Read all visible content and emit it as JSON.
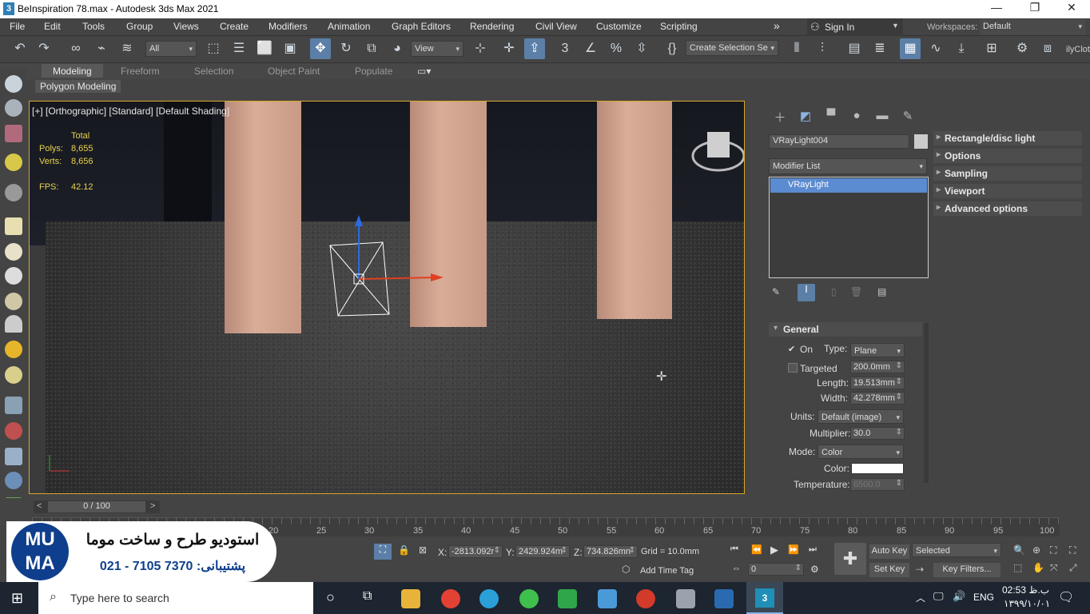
{
  "window": {
    "title": "BeInspiration 78.max - Autodesk 3ds Max 2021",
    "minimize": "—",
    "maximize": "❐",
    "close": "✕"
  },
  "menu": [
    "File",
    "Edit",
    "Tools",
    "Group",
    "Views",
    "Create",
    "Modifiers",
    "Animation",
    "Graph Editors",
    "Rendering",
    "Civil View",
    "Customize",
    "Scripting"
  ],
  "signin": {
    "label": "Sign In"
  },
  "workspaces": {
    "label": "Workspaces:",
    "value": "Default"
  },
  "toolbar": {
    "filter_value": "All",
    "view_value": "View",
    "selection_set_placeholder": "Create Selection Se",
    "cloth_label": "ilyClot"
  },
  "ribbon": {
    "tabs": [
      "Modeling",
      "Freeform",
      "Selection",
      "Object Paint",
      "Populate"
    ],
    "sub_tab": "Polygon Modeling"
  },
  "viewport": {
    "label": "[+] [Orthographic] [Standard] [Default Shading]",
    "stats": {
      "total_label": "Total",
      "polys_label": "Polys:",
      "polys": "8,655",
      "verts_label": "Verts:",
      "verts": "8,656",
      "fps_label": "FPS:",
      "fps": "42.12"
    }
  },
  "command_panel": {
    "object_name": "VRayLight004",
    "modifier_list": "Modifier List",
    "stack_item": "VRayLight",
    "rollouts": [
      "Rectangle/disc light",
      "Options",
      "Sampling",
      "Viewport",
      "Advanced options"
    ],
    "general": {
      "title": "General",
      "on_label": "On",
      "type_label": "Type:",
      "type_value": "Plane",
      "targeted_label": "Targeted",
      "targeted_value": "200.0mm",
      "length_label": "Length:",
      "length_value": "19.513mm",
      "width_label": "Width:",
      "width_value": "42.278mm",
      "units_label": "Units:",
      "units_value": "Default (image)",
      "multiplier_label": "Multiplier:",
      "multiplier_value": "30.0",
      "mode_label": "Mode:",
      "mode_value": "Color",
      "color_label": "Color:",
      "temperature_label": "Temperature:",
      "temperature_value": "6500.0"
    }
  },
  "timeline": {
    "frame": "0 / 100",
    "ticks": [
      "20",
      "25",
      "30",
      "35",
      "40",
      "45",
      "50",
      "55",
      "60",
      "65",
      "70",
      "75",
      "80",
      "85",
      "90",
      "95",
      "100"
    ]
  },
  "status": {
    "x_label": "X:",
    "x": "-2813.092r",
    "y_label": "Y:",
    "y": "2429.924m",
    "z_label": "Z:",
    "z": "734.826mn",
    "grid": "Grid = 10.0mm",
    "add_time_tag": "Add Time Tag",
    "auto_key": "Auto Key",
    "set_key": "Set Key",
    "selected": "Selected",
    "key_filters": "Key Filters...",
    "frame_field": "0"
  },
  "watermark": {
    "logo": "MU MA",
    "line1": "استودیو طرح و ساخت موما",
    "line2": "021 - 7105 7370 :پشتیبانی"
  },
  "taskbar": {
    "search_placeholder": "Type here to search",
    "lang": "ENG",
    "time": "02:53 ب.ظ",
    "date": "۱۳۹۹/۱۰/۰۱"
  }
}
